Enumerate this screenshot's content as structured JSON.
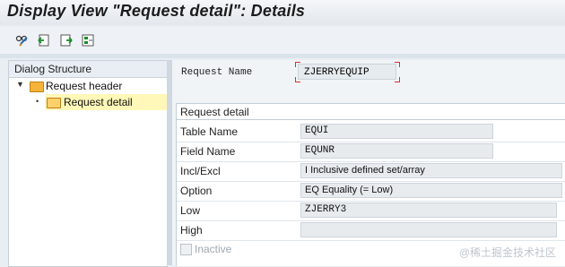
{
  "window": {
    "title": "Display View \"Request detail\": Details"
  },
  "toolbar": {
    "buttons": [
      "glasses-edit-icon",
      "previous-entry-icon",
      "next-entry-icon",
      "variant-icon"
    ]
  },
  "tree": {
    "header": "Dialog Structure",
    "nodes": [
      {
        "label": "Request header",
        "expanded": true
      },
      {
        "label": "Request detail",
        "selected": true
      }
    ]
  },
  "request": {
    "label": "Request Name",
    "value": "ZJERRYEQUIP"
  },
  "group": {
    "title": "Request detail"
  },
  "fields": [
    {
      "label": "Table Name",
      "value": "EQUI"
    },
    {
      "label": "Field Name",
      "value": "EQUNR"
    },
    {
      "label": "Incl/Excl",
      "value": "I Inclusive defined set/array"
    },
    {
      "label": "Option",
      "value": "EQ Equality (= Low)"
    },
    {
      "label": "Low",
      "value": "ZJERRY3"
    },
    {
      "label": "High",
      "value": ""
    }
  ],
  "inactive": {
    "label": "Inactive",
    "checked": false
  },
  "watermark": "@稀土掘金技术社区",
  "colors": {
    "selection": "#fff8b8",
    "folder": "#f6b33a",
    "key_marker": "#d43030"
  }
}
